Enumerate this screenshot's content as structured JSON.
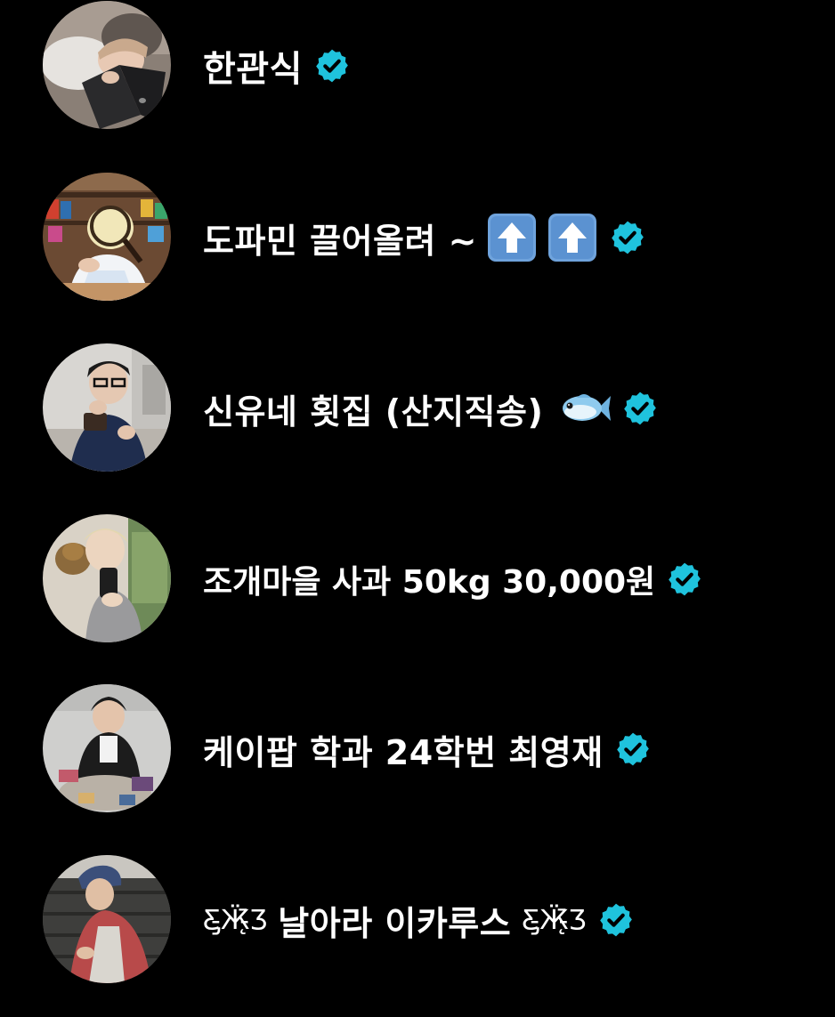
{
  "accounts": [
    {
      "name": "한관식",
      "verified": true
    },
    {
      "name": "도파민 끌어올려 ~",
      "emoji": [
        "up-arrow",
        "up-arrow"
      ],
      "verified": true
    },
    {
      "name": "신유네 횟집 (산지직송)",
      "emoji": [
        "fish"
      ],
      "verified": true
    },
    {
      "name": "조개마을 사과 50kg 30,000원",
      "verified": true
    },
    {
      "name": "케이팝 학과 24학번 최영재",
      "verified": true
    },
    {
      "name": "날아라 이카루스",
      "prefix": "Ƹ̵̡Ӝ̵̨̄Ʒ",
      "suffix": "Ƹ̵̡Ӝ̵̨̄Ʒ",
      "verified": true
    }
  ],
  "colors": {
    "background": "#000000",
    "text": "#ffffff",
    "verified_badge": "#1fc3dd"
  },
  "icons": {
    "verified": "verified-badge-icon",
    "up_arrow": "up-arrow-emoji",
    "fish": "fish-emoji"
  }
}
